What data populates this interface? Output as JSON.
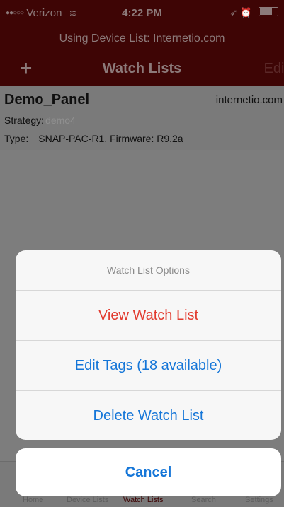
{
  "status_bar": {
    "signal": "●●○○○",
    "carrier": "Verizon",
    "wifi_icon": "≋",
    "time": "4:22 PM",
    "location_icon": "➶",
    "alarm_icon": "⏰"
  },
  "device_bar": {
    "text": "Using Device List: Internetio.com"
  },
  "nav": {
    "add_icon": "+",
    "title": "Watch Lists",
    "edit_label": "Edit"
  },
  "panel": {
    "name": "Demo_Panel",
    "domain": "internetio.com",
    "strategy_label": "Strategy:",
    "strategy_value": "demo4",
    "type_label": "Type:",
    "type_value": "SNAP-PAC-R1.  Firmware: R9.2a"
  },
  "tabs": [
    {
      "label": "Home"
    },
    {
      "label": "Device Lists"
    },
    {
      "label": "Watch Lists"
    },
    {
      "label": "Search"
    },
    {
      "label": "Settings"
    }
  ],
  "action_sheet": {
    "title": "Watch List Options",
    "options": [
      {
        "label": "View Watch List",
        "style": "destructive"
      },
      {
        "label": "Edit Tags (18 available)",
        "style": "default"
      },
      {
        "label": "Delete Watch List",
        "style": "default"
      }
    ],
    "cancel_label": "Cancel"
  },
  "colors": {
    "nav_background": "#3e0505",
    "destructive": "#e23a2e",
    "action_blue": "#1576d8"
  }
}
